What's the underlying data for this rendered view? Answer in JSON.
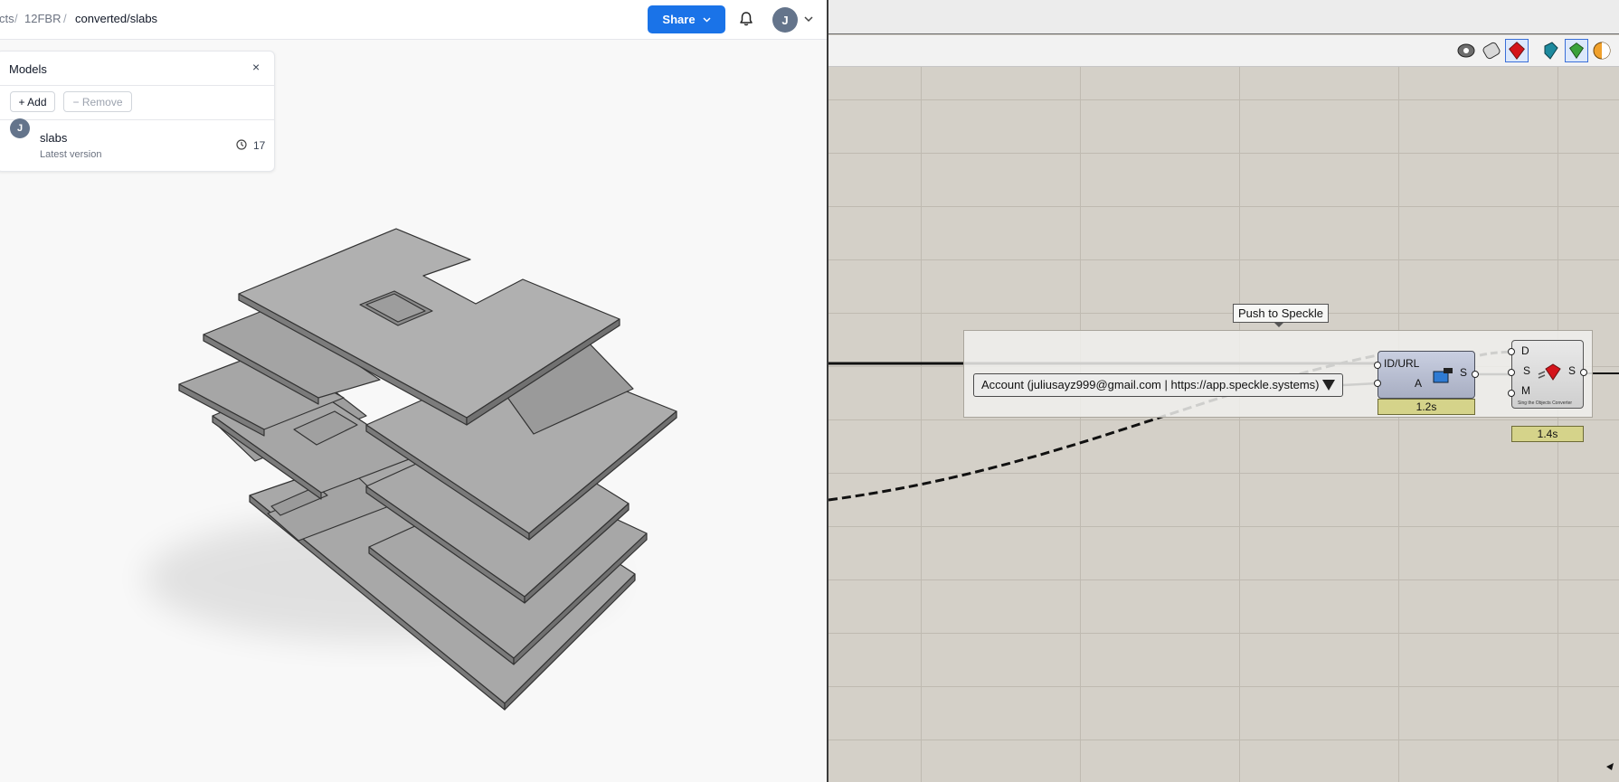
{
  "viewer": {
    "breadcrumb": [
      {
        "label": "cts"
      },
      {
        "label": "12FBR"
      },
      {
        "label": "converted/slabs"
      }
    ],
    "share_label": "Share",
    "user_initial": "J",
    "models_panel": {
      "title": "Models",
      "close": "×",
      "add_label": "+ Add",
      "remove_label": "− Remove",
      "items": [
        {
          "avatar": "J",
          "name": "slabs",
          "subtitle": "Latest version",
          "versions": "17"
        }
      ]
    },
    "colors": {
      "accent": "#1a73e8",
      "avatar": "#64748b"
    }
  },
  "grasshopper": {
    "group_label": "Push to Speckle",
    "account_dropdown": "Account (juliusayz999@gmail.com | https://app.speckle.systems)",
    "stream_component": {
      "inputs": [
        "ID/URL",
        "A"
      ],
      "outputs": [
        "S"
      ],
      "time": "1.2s"
    },
    "send_component": {
      "inputs": [
        "D",
        "S",
        "M"
      ],
      "outputs": [
        "S"
      ],
      "caption": "Sing the Objects Converter",
      "time": "1.4s"
    },
    "toolbar_icons": [
      "preview-toggle-icon",
      "wire-display-icon",
      "red-gem-icon",
      "speckle-cube-icon",
      "send-icon",
      "shading-icon"
    ]
  }
}
